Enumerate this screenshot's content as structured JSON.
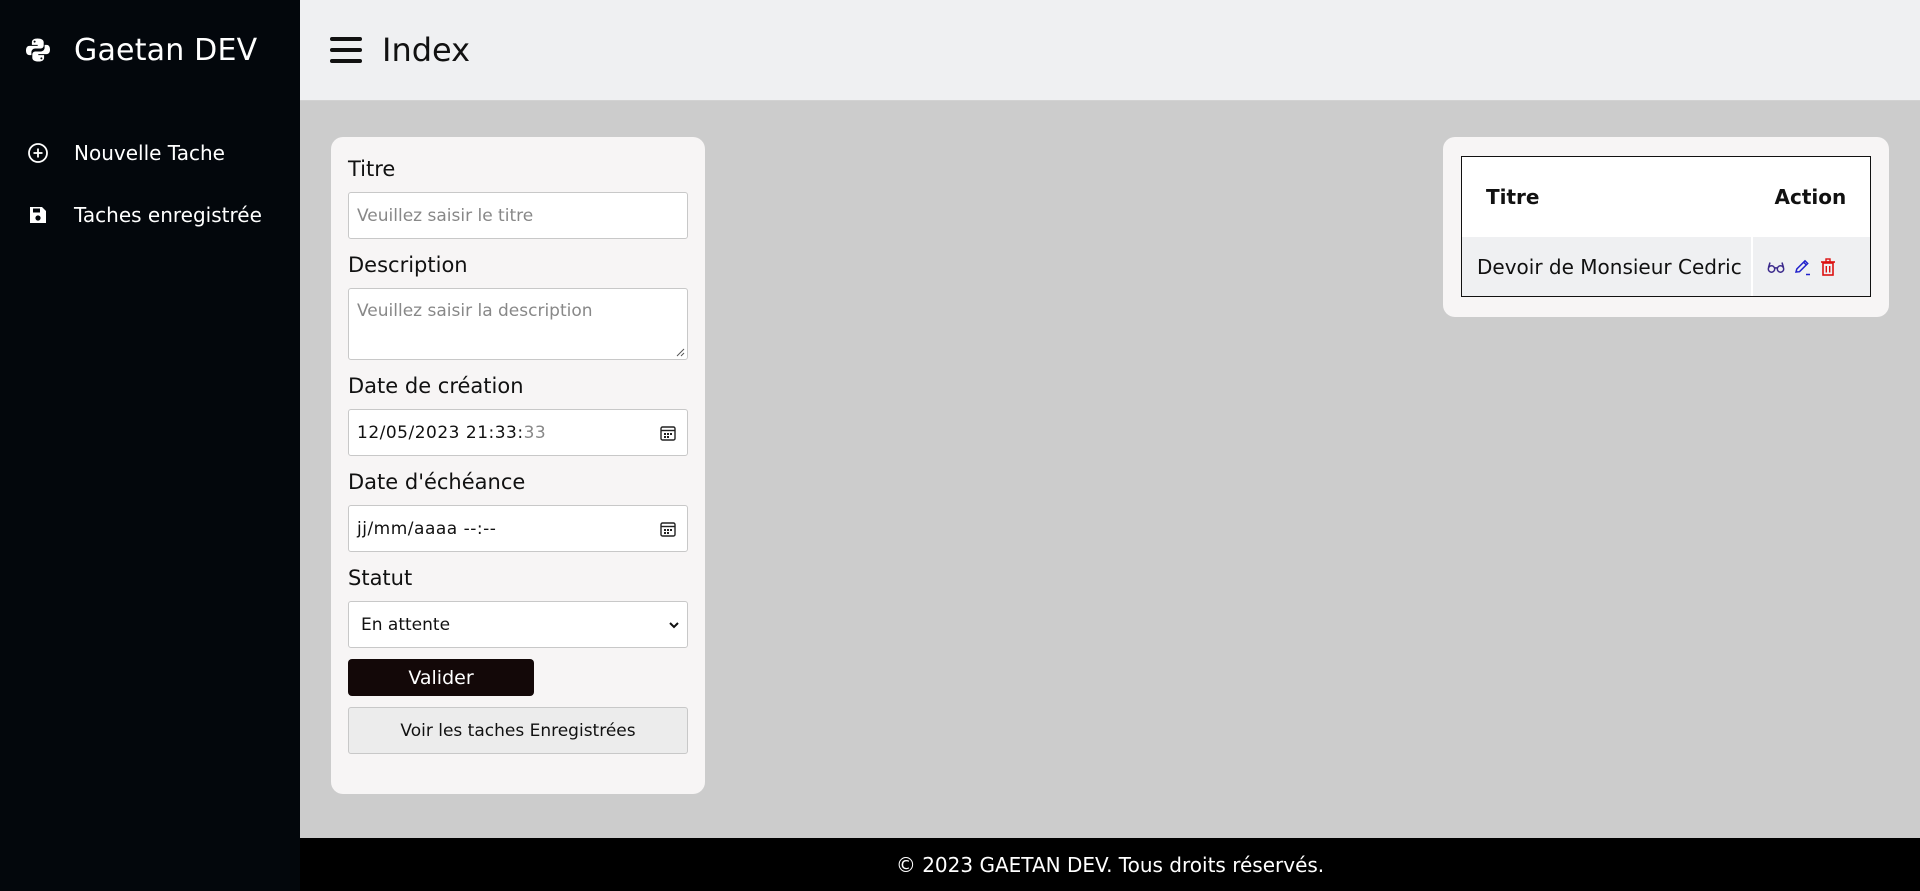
{
  "sidebar": {
    "brand": "Gaetan DEV",
    "brand_icon": "python-icon",
    "items": [
      {
        "label": "Nouvelle Tache",
        "icon": "plus-circle-icon"
      },
      {
        "label": "Taches enregistrée",
        "icon": "save-icon"
      }
    ]
  },
  "header": {
    "title": "Index",
    "menu_icon": "hamburger-icon"
  },
  "form": {
    "titre_label": "Titre",
    "titre_placeholder": "Veuillez saisir le titre",
    "description_label": "Description",
    "description_placeholder": "Veuillez saisir la description",
    "creation_label": "Date de création",
    "creation_value": "12/05/2023  21:33:",
    "creation_seconds": "33",
    "echeance_label": "Date d'échéance",
    "echeance_value": "jj/mm/aaaa  --:--",
    "statut_label": "Statut",
    "statut_value": "En attente",
    "submit": "Valider",
    "voir": "Voir les taches Enregistrées"
  },
  "table": {
    "headers": [
      "Titre",
      "Action"
    ],
    "rows": [
      {
        "titre": "Devoir de Monsieur Cedric",
        "actions": [
          "view-icon",
          "edit-icon",
          "delete-icon"
        ]
      }
    ]
  },
  "colors": {
    "sidebar_bg": "#03070c",
    "view": "#3c2a8c",
    "edit": "#2222cc",
    "delete": "#dd1111"
  },
  "footer": {
    "text": "© 2023 GAETAN DEV. Tous droits réservés."
  }
}
